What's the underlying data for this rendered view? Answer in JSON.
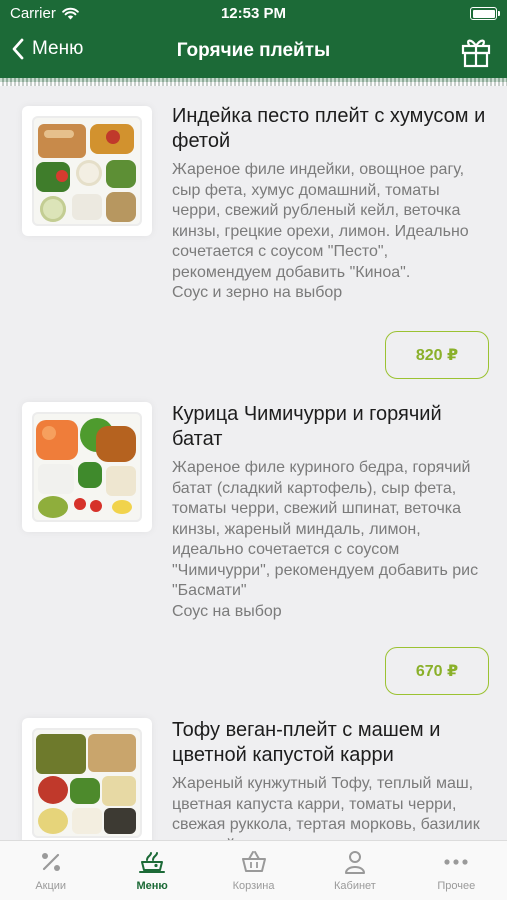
{
  "status": {
    "carrier": "Carrier",
    "time": "12:53 PM"
  },
  "nav": {
    "back_label": "Меню",
    "title": "Горячие плейты"
  },
  "colors": {
    "brand": "#1c6a37",
    "price_accent": "#8ab02a"
  },
  "items": [
    {
      "title": "Индейка песто плейт с хумусом и фетой",
      "description": "Жареное филе индейки, овощное рагу, сыр фета, хумус домашний, томаты черри, свежий рубленый кейл, веточка кинзы, грецкие орехи, лимон. Идеально сочетается с соусом \"Песто\", рекомендуем добавить \"Киноа\".\nСоус и зерно на выбор",
      "price": "820 ₽"
    },
    {
      "title": "Курица Чимичурри и горячий батат",
      "description": "Жареное филе куриного бедра, горячий батат (сладкий картофель), сыр фета, томаты черри, свежий шпинат, веточка кинзы, жареный миндаль, лимон, идеально сочетается с соусом \"Чимичурри\", рекомендуем добавить рис \"Басмати\"\nСоус на выбор",
      "price": "670 ₽"
    },
    {
      "title": "Тофу веган-плейт с машем и цветной капустой карри",
      "description": "Жареный кунжутный Тофу, теплый маш, цветная капуста карри, томаты черри, свежая руккола, тертая морковь, базилик зеленый, пряные"
    }
  ],
  "tabs": [
    {
      "label": "Акции",
      "icon": "percent-icon"
    },
    {
      "label": "Меню",
      "icon": "menu-plate-icon",
      "active": true
    },
    {
      "label": "Корзина",
      "icon": "basket-icon"
    },
    {
      "label": "Кабинет",
      "icon": "person-icon"
    },
    {
      "label": "Прочее",
      "icon": "more-dots-icon"
    }
  ]
}
